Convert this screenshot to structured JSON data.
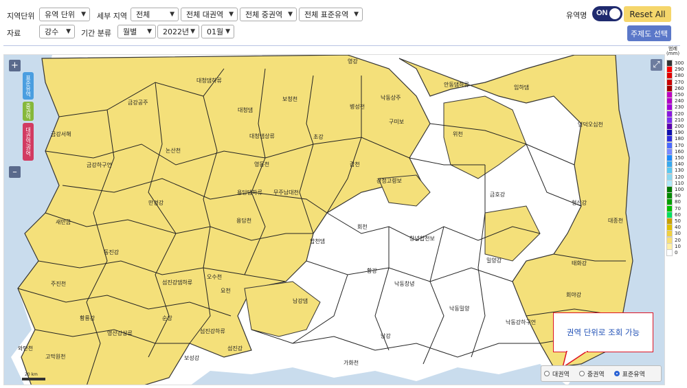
{
  "toolbar": {
    "unit_label": "지역단위",
    "unit_select": "유역 단위",
    "region_label": "세부 지역",
    "region_select": "전체",
    "big_basin": "전체 대권역",
    "mid_basin": "전체 중권역",
    "std_basin": "전체 표준유역",
    "data_label": "자료",
    "data_select": "강수",
    "period_label": "기간 분류",
    "period_select": "월별",
    "year_select": "2022년",
    "month_select": "01월",
    "basin_name_label": "유역명",
    "toggle_state": "ON",
    "reset_label": "Reset All",
    "theme_label": "주제도 선택"
  },
  "map": {
    "zoom_in": "+",
    "zoom_out": "–",
    "expand_icon": "expand-icon",
    "side_tabs": [
      "표준유역",
      "중권역",
      "대권역/권역"
    ],
    "callout": "권역 단위로 조회 가능",
    "radios": [
      {
        "label": "대권역",
        "selected": false
      },
      {
        "label": "중권역",
        "selected": false
      },
      {
        "label": "표준유역",
        "selected": true
      }
    ],
    "scale_text": "20 km",
    "labels": [
      "영강",
      "금강공주",
      "금강서해",
      "논산천",
      "금강하구언",
      "만경강",
      "새만금",
      "동진강",
      "주진천",
      "황룡강",
      "와탄천",
      "고막원천",
      "섬진강댐하류",
      "오수천",
      "순창",
      "영산강상류",
      "요천",
      "섬진강하류",
      "보성강",
      "남강댐",
      "남강",
      "섬진강",
      "대청댐하류",
      "대청댐",
      "보청천",
      "병성천",
      "초강",
      "갑천",
      "대청댐상류",
      "영동천",
      "용담댐하류",
      "무주남대천",
      "용담천",
      "합천댐",
      "회천",
      "황강",
      "창녕합천보",
      "낙동창녕",
      "낙동밀양",
      "밀양강",
      "금호강",
      "위천",
      "강정고령보",
      "구미보",
      "낙동상주",
      "안동댐하류",
      "임하댐",
      "영덕오십천",
      "형산강",
      "태화강",
      "대종천",
      "회야강",
      "낙동강하구언",
      "가화천"
    ]
  },
  "legend": {
    "title": "범례",
    "unit": "(mm)",
    "steps": [
      {
        "v": "300",
        "c": "#333333"
      },
      {
        "v": "290",
        "c": "#ff0000"
      },
      {
        "v": "280",
        "c": "#e00000"
      },
      {
        "v": "270",
        "c": "#cc0000"
      },
      {
        "v": "260",
        "c": "#a30000"
      },
      {
        "v": "250",
        "c": "#c000c0"
      },
      {
        "v": "240",
        "c": "#b200c8"
      },
      {
        "v": "230",
        "c": "#a000d8"
      },
      {
        "v": "220",
        "c": "#8a18e0"
      },
      {
        "v": "210",
        "c": "#7a30f0"
      },
      {
        "v": "200",
        "c": "#5a00b0"
      },
      {
        "v": "190",
        "c": "#1010b0"
      },
      {
        "v": "180",
        "c": "#3030e0"
      },
      {
        "v": "170",
        "c": "#4a6aff"
      },
      {
        "v": "160",
        "c": "#7a8aff"
      },
      {
        "v": "150",
        "c": "#1a8aff"
      },
      {
        "v": "140",
        "c": "#3aaaee"
      },
      {
        "v": "130",
        "c": "#5ac8f0"
      },
      {
        "v": "120",
        "c": "#8ad8f0"
      },
      {
        "v": "110",
        "c": "#b0e8f8"
      },
      {
        "v": "100",
        "c": "#007a00"
      },
      {
        "v": "90",
        "c": "#008a00"
      },
      {
        "v": "80",
        "c": "#00a000"
      },
      {
        "v": "70",
        "c": "#00c000"
      },
      {
        "v": "60",
        "c": "#00e060"
      },
      {
        "v": "50",
        "c": "#c8a000"
      },
      {
        "v": "40",
        "c": "#e0c000"
      },
      {
        "v": "30",
        "c": "#f0d040"
      },
      {
        "v": "20",
        "c": "#f8e078"
      },
      {
        "v": "10",
        "c": "#fff0a8"
      },
      {
        "v": "0",
        "c": "#ffffff"
      }
    ]
  },
  "colors": {
    "fill": "#f4e07a",
    "sea": "#c9dced",
    "toggle": "#1f2a6e",
    "reset": "#f5d66b",
    "theme": "#5b78c9"
  }
}
